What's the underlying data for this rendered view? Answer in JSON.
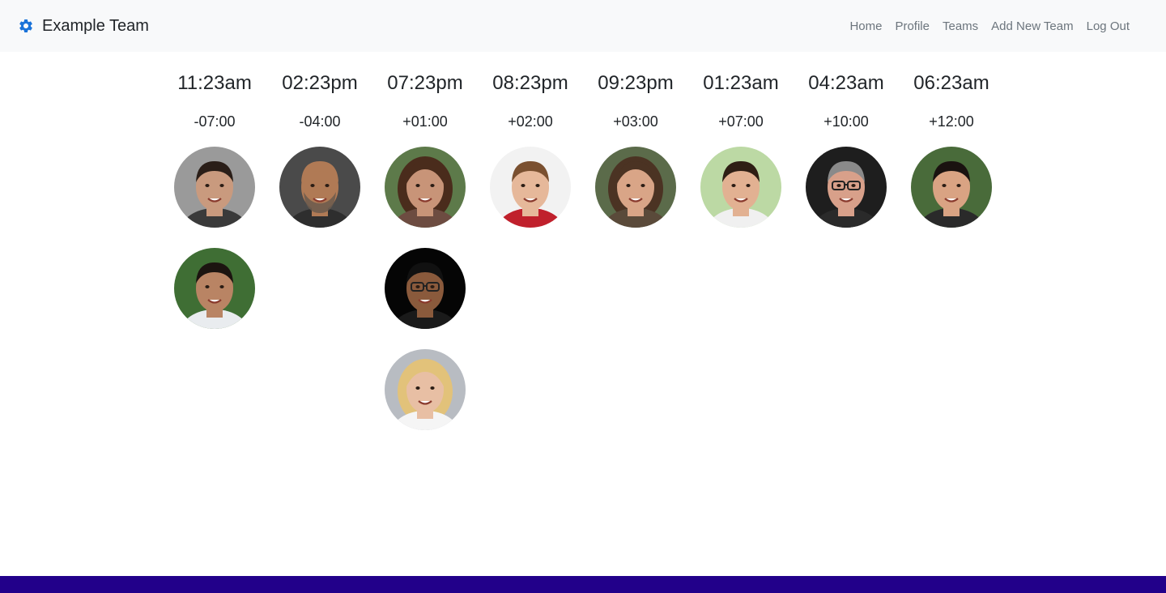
{
  "navbar": {
    "brand_icon": "gear-icon",
    "brand_color": "#1a73d9",
    "brand_text": "Example Team",
    "links": [
      "Home",
      "Profile",
      "Teams",
      "Add New Team",
      "Log Out"
    ]
  },
  "zones": [
    {
      "time": "11:23am",
      "offset": "-07:00",
      "members": [
        {
          "skin": "#c99a7e",
          "hair": "#2a1e18",
          "bg": "#9a9a9a",
          "shirt": "#3a3a3a"
        },
        {
          "skin": "#b98464",
          "hair": "#1c1410",
          "bg": "#3f6e34",
          "shirt": "#e9ecef"
        }
      ]
    },
    {
      "time": "02:23pm",
      "offset": "-04:00",
      "members": [
        {
          "skin": "#b07a55",
          "hair": "#b07a55",
          "bg": "#4a4a4a",
          "shirt": "#2e2e2e",
          "beard": true
        }
      ]
    },
    {
      "time": "07:23pm",
      "offset": "+01:00",
      "members": [
        {
          "skin": "#c89478",
          "hair": "#4a2c1c",
          "bg": "#5d7a4a",
          "shirt": "#6d4c41",
          "longhair": true
        },
        {
          "skin": "#8a5a3c",
          "hair": "#111111",
          "bg": "#050505",
          "shirt": "#1a1a1a",
          "glasses": true
        },
        {
          "skin": "#e8bfa4",
          "hair": "#e2c27a",
          "bg": "#b8bcc2",
          "shirt": "#f5f5f5",
          "longhair": true
        }
      ]
    },
    {
      "time": "08:23pm",
      "offset": "+02:00",
      "members": [
        {
          "skin": "#e6b89a",
          "hair": "#7a5030",
          "bg": "#f2f2f2",
          "shirt": "#c0202c"
        }
      ]
    },
    {
      "time": "09:23pm",
      "offset": "+03:00",
      "members": [
        {
          "skin": "#d9a587",
          "hair": "#4b3323",
          "bg": "#5b6b4a",
          "shirt": "#5a4a3a",
          "longhair": true
        }
      ]
    },
    {
      "time": "01:23am",
      "offset": "+07:00",
      "members": [
        {
          "skin": "#e2b192",
          "hair": "#2e1e14",
          "bg": "#bcd9a4",
          "shirt": "#f0f0f0"
        }
      ]
    },
    {
      "time": "04:23am",
      "offset": "+10:00",
      "members": [
        {
          "skin": "#d8a08a",
          "hair": "#8a8a8a",
          "bg": "#1e1e1e",
          "shirt": "#2a2a2a",
          "glasses": true
        }
      ]
    },
    {
      "time": "06:23am",
      "offset": "+12:00",
      "members": [
        {
          "skin": "#d9a383",
          "hair": "#1a1210",
          "bg": "#496b3a",
          "shirt": "#2a2a2a"
        }
      ]
    }
  ],
  "footer_color": "#22008a"
}
